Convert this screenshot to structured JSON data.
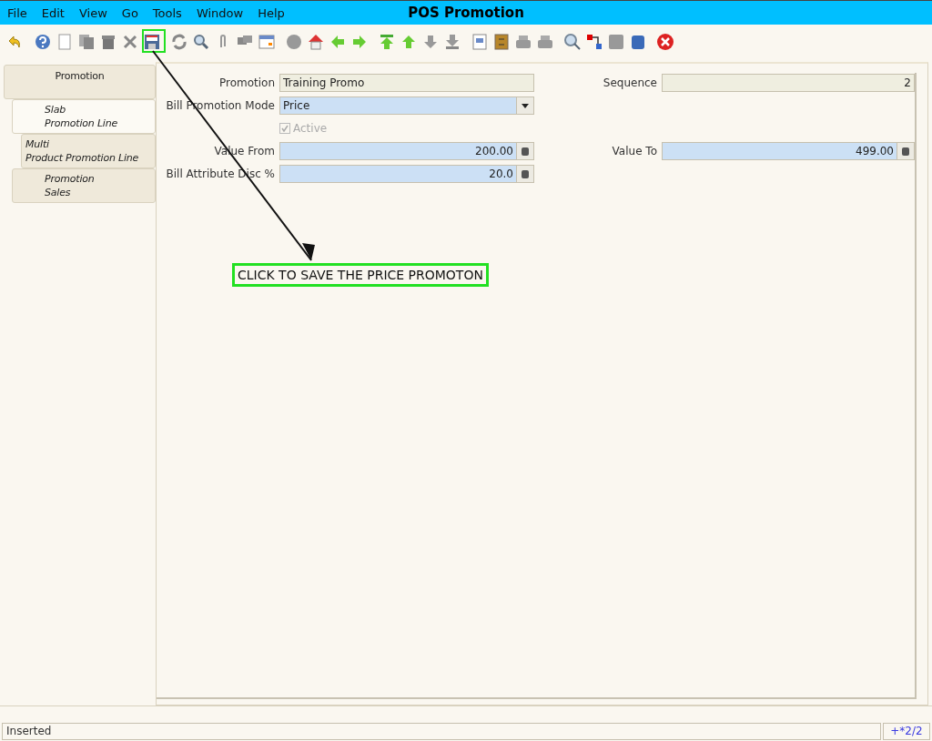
{
  "window": {
    "title": "POS Promotion"
  },
  "menu": [
    {
      "label": "File"
    },
    {
      "label": "Edit"
    },
    {
      "label": "View"
    },
    {
      "label": "Go"
    },
    {
      "label": "Tools"
    },
    {
      "label": "Window"
    },
    {
      "label": "Help"
    }
  ],
  "tabs": [
    {
      "label": "Promotion",
      "selected": false,
      "children": [
        {
          "label": "Slab\nPromotion Line",
          "selected": true,
          "children": [
            {
              "label": "Multi\nProduct Promotion Line",
              "selected": false
            }
          ]
        },
        {
          "label": "Promotion\nSales",
          "selected": false
        }
      ]
    }
  ],
  "form": {
    "rows": [
      {
        "left": {
          "kind": "text",
          "label": "Promotion",
          "value": "Training Promo",
          "editable": false
        },
        "right": {
          "kind": "number",
          "label": "Sequence",
          "value": "2",
          "editable": false
        }
      },
      {
        "left": {
          "kind": "select",
          "label": "Bill Promotion Mode",
          "value": "Price",
          "editable": true
        }
      },
      {
        "left": {
          "kind": "checkbox",
          "label": "Active",
          "checked": true,
          "disabled": true
        }
      },
      {
        "left": {
          "kind": "number",
          "label": "Value From",
          "value": "200.00",
          "editable": true,
          "calculator": true
        },
        "right": {
          "kind": "number",
          "label": "Value To",
          "value": "499.00",
          "editable": true,
          "calculator": true
        }
      },
      {
        "left": {
          "kind": "number",
          "label": "Bill Attribute Disc %",
          "value": "20.0",
          "editable": true,
          "calculator": true
        }
      }
    ]
  },
  "annotation": {
    "text": "CLICK TO SAVE THE PRICE PROMOTON"
  },
  "status_bar": {
    "message": "Inserted",
    "record": "+*2/2"
  }
}
